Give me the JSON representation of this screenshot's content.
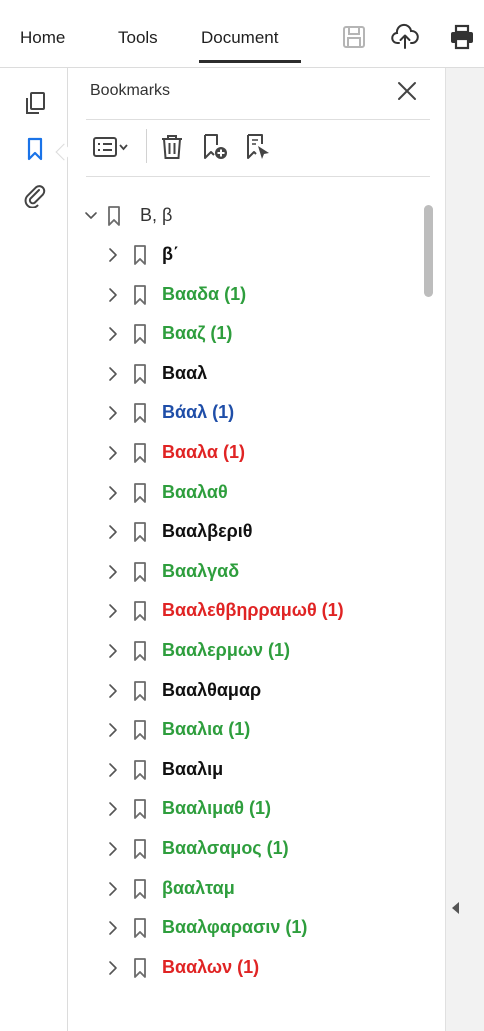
{
  "menu": {
    "items": [
      {
        "label": "Home"
      },
      {
        "label": "Tools"
      },
      {
        "label": "Document"
      }
    ],
    "icons": [
      "save-icon",
      "upload-cloud-icon",
      "print-icon"
    ]
  },
  "rail": {
    "icons": [
      "pages-icon",
      "bookmark-icon",
      "attachment-icon"
    ],
    "active": "bookmark-icon"
  },
  "panel": {
    "title": "Bookmarks",
    "toolbar_icons": [
      "options-menu-icon",
      "delete-icon",
      "new-bookmark-icon",
      "bookmark-from-selection-icon"
    ]
  },
  "colors": {
    "green": "#2e9e3d",
    "blue": "#1f4ea8",
    "red": "#e02424",
    "black": "#111111",
    "icon": "#6b6b6b",
    "accent": "#1a73e8"
  },
  "bookmarks": {
    "root": {
      "label": "Β, β",
      "expanded": true
    },
    "items": [
      {
        "label": "β΄",
        "color": "black"
      },
      {
        "label": "Βααδα (1)",
        "color": "green"
      },
      {
        "label": "Βααζ (1)",
        "color": "green"
      },
      {
        "label": "Βααλ",
        "color": "black"
      },
      {
        "label": "Βάαλ (1)",
        "color": "blue"
      },
      {
        "label": "Βααλα (1)",
        "color": "red"
      },
      {
        "label": "Βααλαθ",
        "color": "green"
      },
      {
        "label": "Βααλβεριθ",
        "color": "black"
      },
      {
        "label": "Βααλγαδ",
        "color": "green"
      },
      {
        "label": "Βααλεθβηρραμωθ (1)",
        "color": "red"
      },
      {
        "label": "Βααλερμων (1)",
        "color": "green"
      },
      {
        "label": "Βααλθαμαρ",
        "color": "black"
      },
      {
        "label": "Βααλια (1)",
        "color": "green"
      },
      {
        "label": "Βααλιμ",
        "color": "black"
      },
      {
        "label": "Βααλιμαθ (1)",
        "color": "green"
      },
      {
        "label": "Βααλσαμος (1)",
        "color": "green"
      },
      {
        "label": "βααλταμ",
        "color": "green"
      },
      {
        "label": "Βααλφαρασιν (1)",
        "color": "green"
      },
      {
        "label": "Βααλων (1)",
        "color": "red"
      }
    ]
  }
}
